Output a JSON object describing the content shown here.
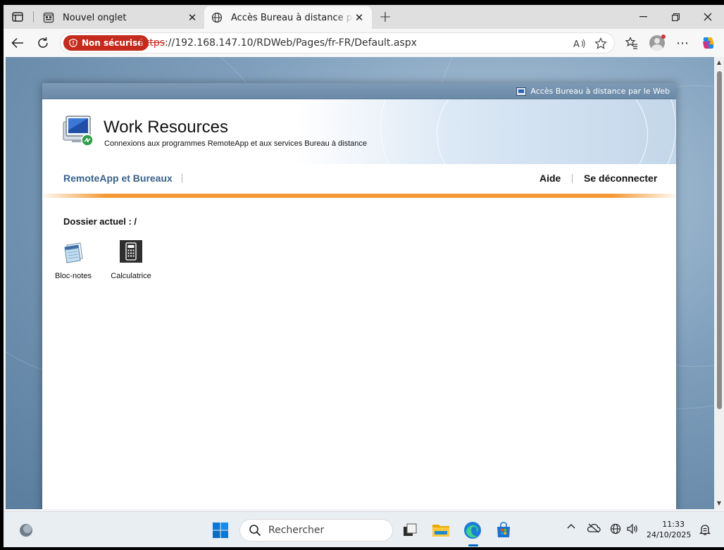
{
  "browser": {
    "tabs": [
      {
        "title": "Nouvel onglet",
        "favicon": "newtab-icon",
        "active": false
      },
      {
        "title": "Accès Bureau à distance par le Web",
        "favicon": "globe-icon",
        "active": true
      }
    ],
    "security_badge": "Non sécurisé",
    "url_scheme": "https",
    "url_rest": "://192.168.147.10/RDWeb/Pages/fr-FR/Default.aspx"
  },
  "page": {
    "topbar_brand": "Accès Bureau à distance par le Web",
    "title": "Work Resources",
    "subtitle": "Connexions aux programmes RemoteApp et aux services Bureau à distance",
    "nav": {
      "primary": "RemoteApp et Bureaux",
      "help": "Aide",
      "logout": "Se déconnecter"
    },
    "folder_label": "Dossier actuel : /",
    "apps": [
      {
        "name": "Bloc-notes",
        "icon": "notepad-icon"
      },
      {
        "name": "Calculatrice",
        "icon": "calculator-icon"
      }
    ]
  },
  "taskbar": {
    "search_placeholder": "Rechercher",
    "time": "11:33",
    "date": "24/10/2025"
  },
  "colors": {
    "security_red": "#c42b1c",
    "nav_blue": "#3a6189",
    "accent_orange": "#f39a35",
    "taskbar_bg": "#e9eef3"
  }
}
